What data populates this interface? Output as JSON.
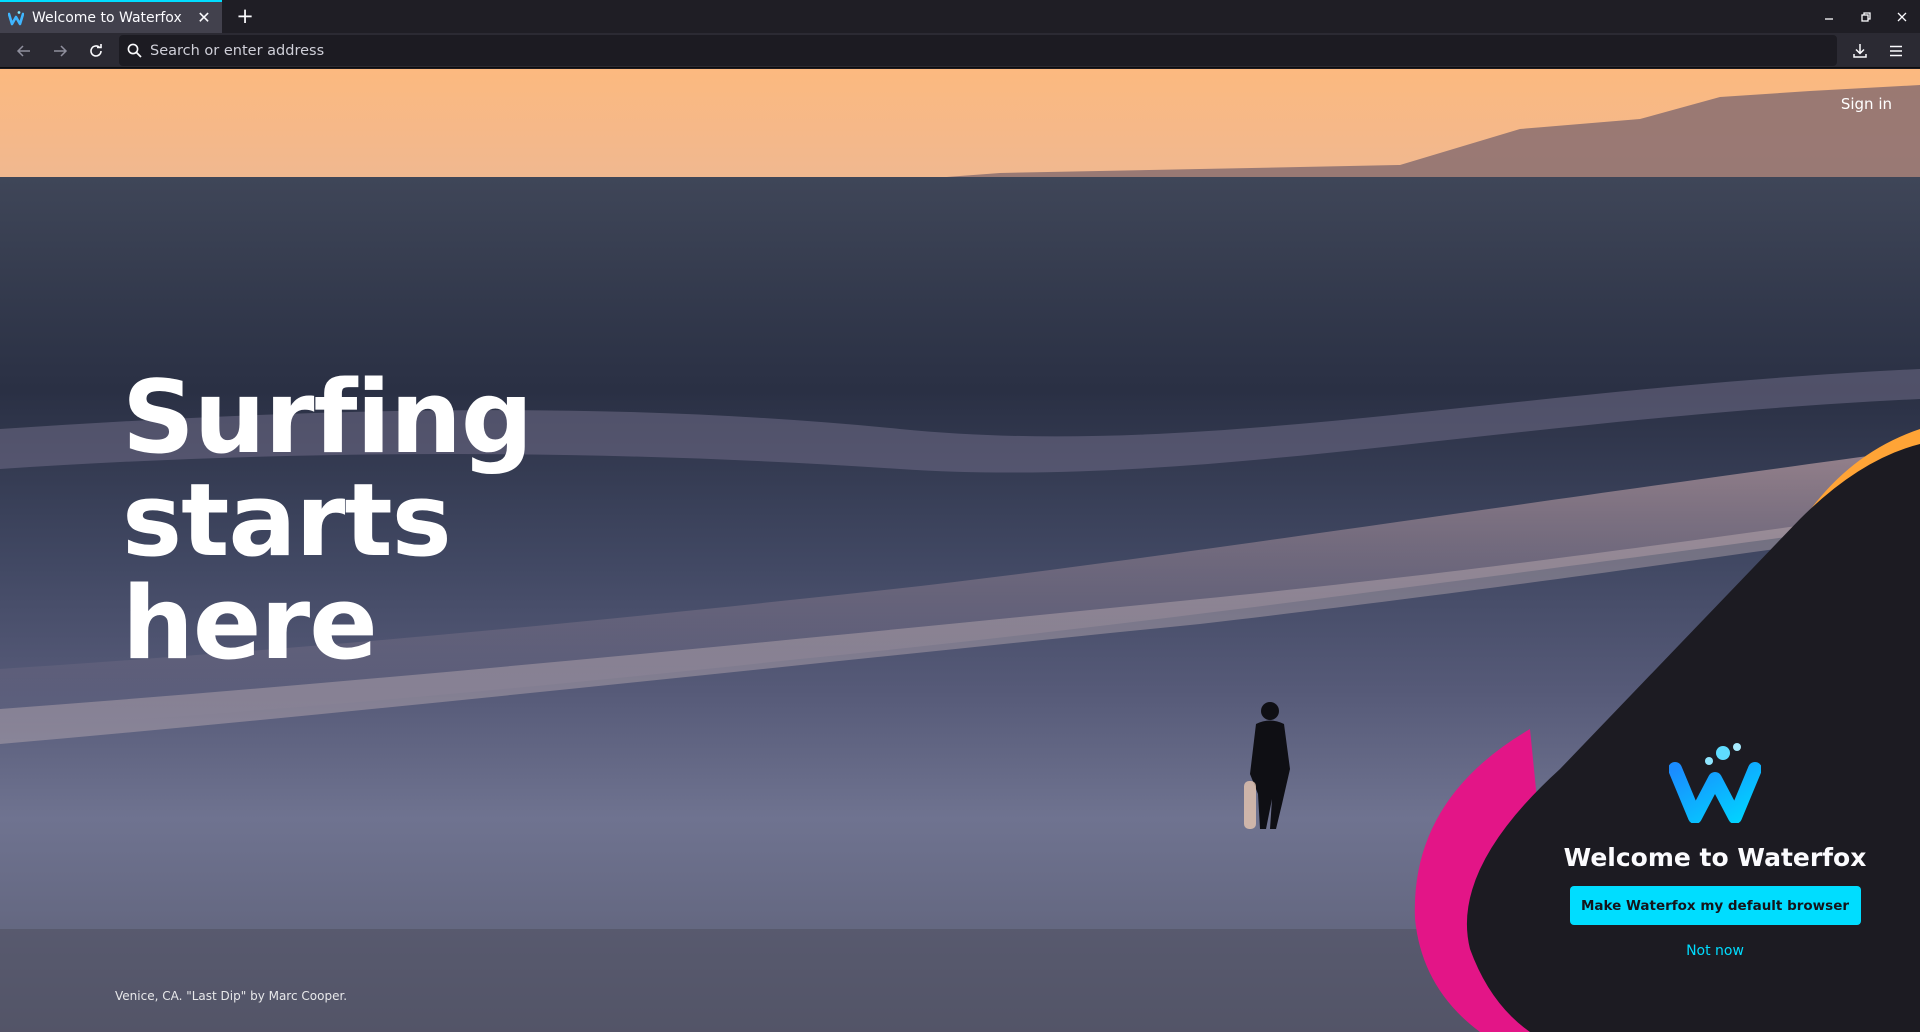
{
  "tabs": [
    {
      "title": "Welcome to Waterfox",
      "active": true
    }
  ],
  "toolbar": {
    "address_placeholder": "Search or enter address"
  },
  "page": {
    "sign_in": "Sign in",
    "hero_lines": [
      "Surfing",
      "starts",
      "here"
    ],
    "photo_credit": "Venice, CA. \"Last Dip\" by Marc Cooper."
  },
  "welcome_panel": {
    "title": "Welcome to Waterfox",
    "primary_button": "Make Waterfox my default browser",
    "secondary_link": "Not now"
  },
  "icons": {
    "back": "arrow-left-icon",
    "forward": "arrow-right-icon",
    "reload": "reload-icon",
    "search": "search-icon",
    "downloads": "download-icon",
    "menu": "hamburger-menu-icon",
    "new_tab": "plus-icon",
    "close_tab": "close-icon"
  },
  "colors": {
    "accent": "#00ddff",
    "panel_dark": "#1c1b22",
    "shape_orange": "#ffa436",
    "shape_pink": "#e31587"
  }
}
